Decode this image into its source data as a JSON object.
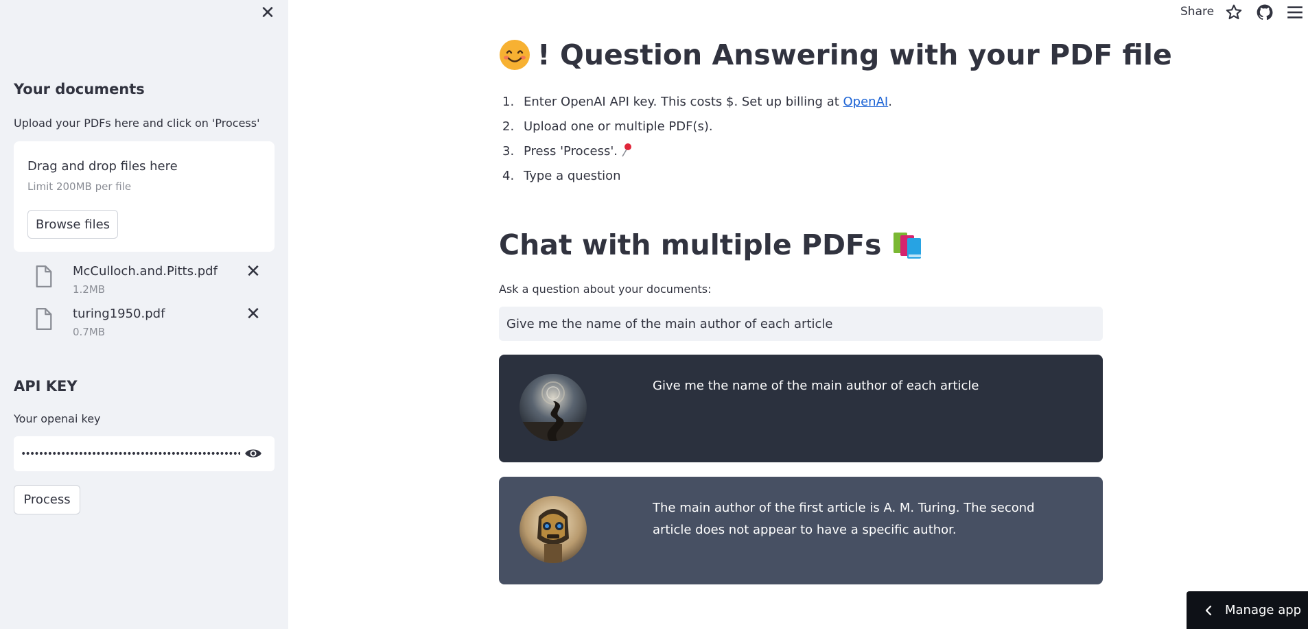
{
  "sidebar": {
    "close_icon": "close-icon",
    "documents_heading": "Your documents",
    "upload_caption": "Upload your PDFs here and click on 'Process'",
    "uploader": {
      "title": "Drag and drop files here",
      "limit": "Limit 200MB per file",
      "browse_label": "Browse files"
    },
    "files": [
      {
        "name": "McCulloch.and.Pitts.pdf",
        "size": "1.2MB"
      },
      {
        "name": "turing1950.pdf",
        "size": "0.7MB"
      }
    ],
    "api_heading": "API KEY",
    "api_label": "Your openai key",
    "api_value": "••••••••••••••••••••••••••••••••••••••••••••••••••••",
    "process_label": "Process"
  },
  "toolbar": {
    "share_label": "Share"
  },
  "main": {
    "title": "! Question Answering with your PDF file",
    "steps": [
      {
        "num": "1.",
        "text": "Enter OpenAI API key. This costs $. Set up billing at ",
        "link": "OpenAI",
        "after": "."
      },
      {
        "num": "2.",
        "text": "Upload one or multiple PDF(s)."
      },
      {
        "num": "3.",
        "text": "Press 'Process'."
      },
      {
        "num": "4.",
        "text": "Type a question"
      }
    ],
    "chat_title": "Chat with multiple PDFs",
    "question_label": "Ask a question about your documents:",
    "question_value": "Give me the name of the main author of each article",
    "messages": [
      {
        "role": "user",
        "text": "Give me the name of the main author of each article"
      },
      {
        "role": "bot",
        "text": "The main author of the first article is A. M. Turing. The second article does not appear to have a specific author."
      }
    ]
  },
  "manage_app_label": "Manage app",
  "colors": {
    "sidebar_bg": "#f0f2f6",
    "user_msg_bg": "#2b313e",
    "bot_msg_bg": "#475063",
    "link": "#1c63d5",
    "manage_bg": "#0e1117"
  }
}
